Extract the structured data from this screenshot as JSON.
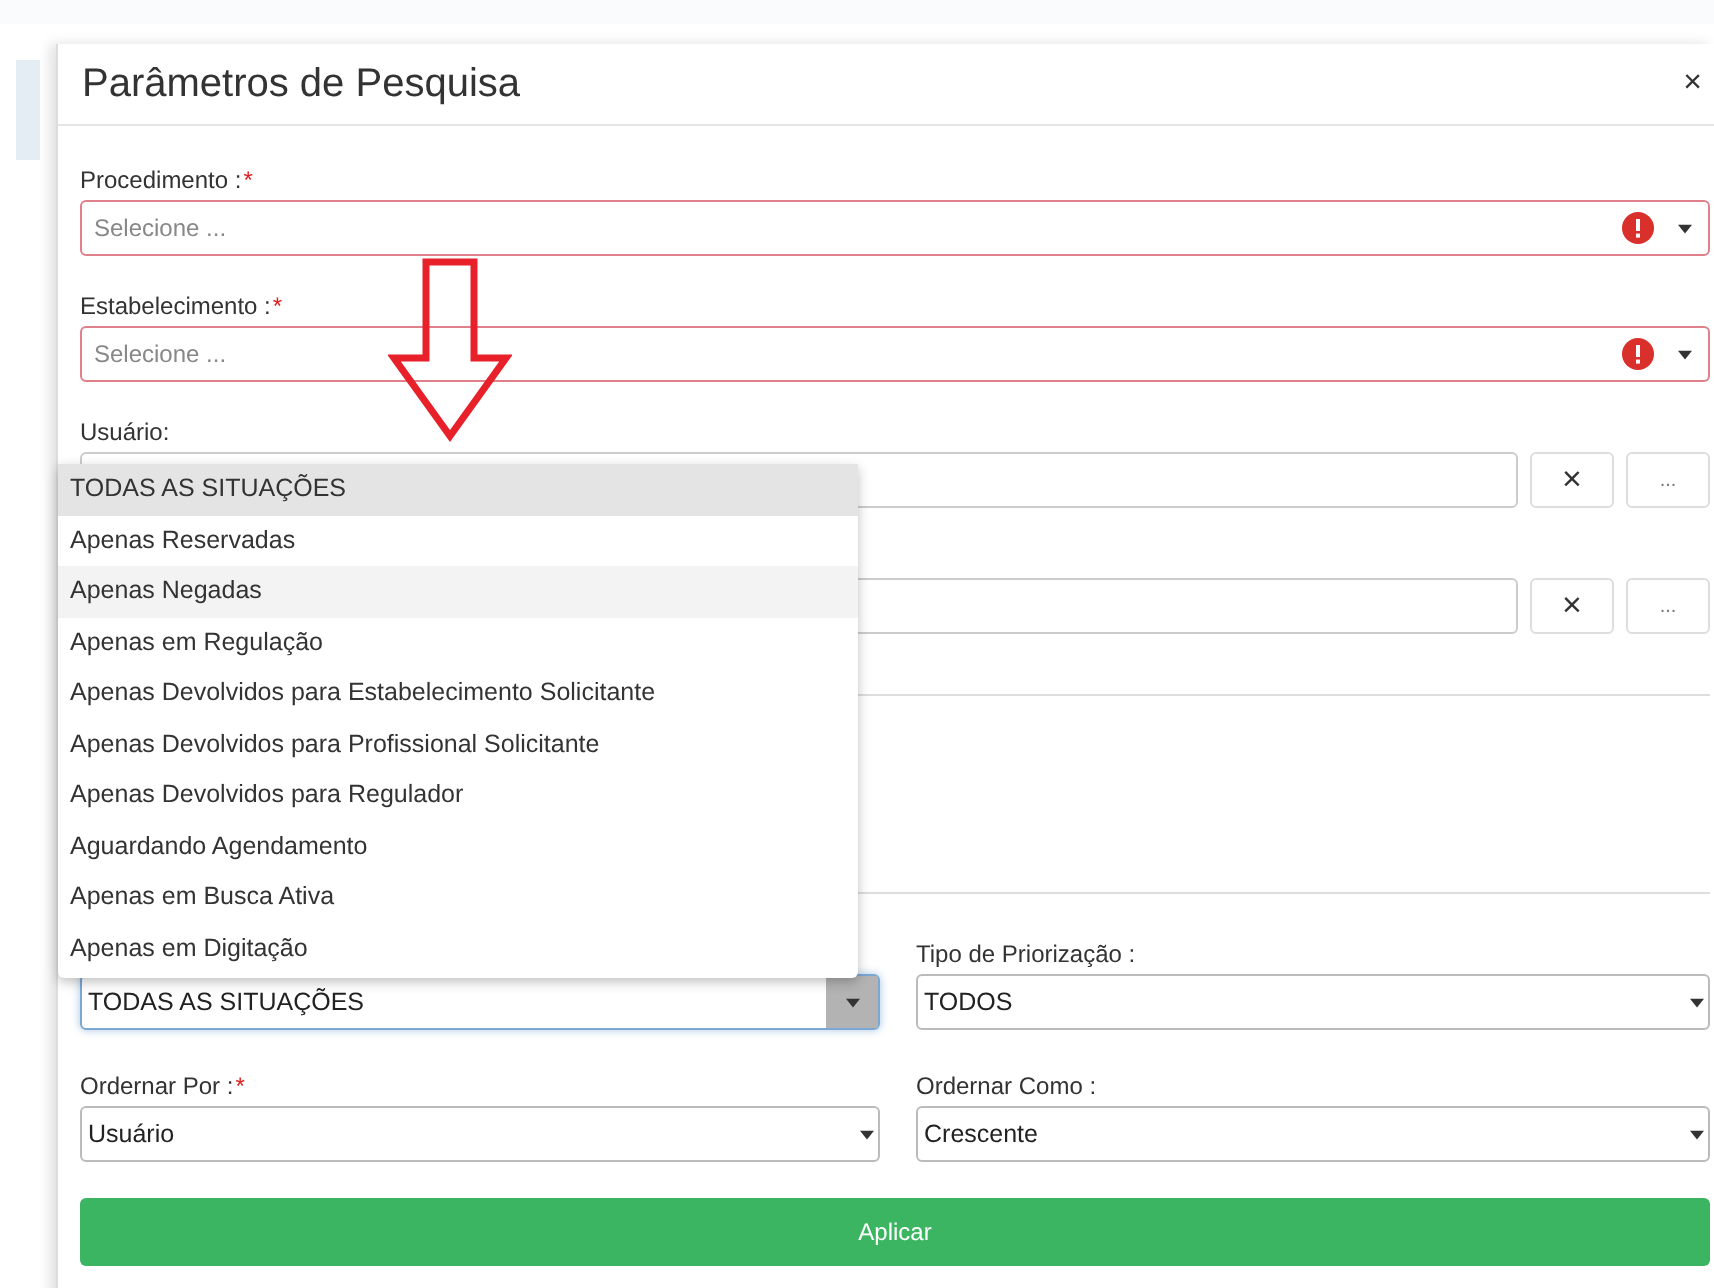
{
  "dialog": {
    "title": "Parâmetros de Pesquisa",
    "close": "×"
  },
  "selects": [
    {
      "label": "Procedimento :",
      "required_mark": "*",
      "placeholder": "Selecione ...",
      "error": true
    },
    {
      "label": "Estabelecimento :",
      "required_mark": "*",
      "placeholder": "Selecione ...",
      "error": true
    }
  ],
  "lookups": [
    {
      "label": "Usuário:",
      "clear": "×",
      "browse": "..."
    },
    {
      "clear": "×",
      "browse": "..."
    }
  ],
  "situation": {
    "value": "TODAS AS SITUAÇÕES",
    "expanded": true,
    "options": [
      {
        "label": "TODAS AS SITUAÇÕES",
        "selected": true,
        "hovered": false
      },
      {
        "label": "Apenas Reservadas",
        "selected": false,
        "hovered": false
      },
      {
        "label": "Apenas Negadas",
        "selected": false,
        "hovered": true
      },
      {
        "label": "Apenas em Regulação",
        "selected": false,
        "hovered": false
      },
      {
        "label": "Apenas Devolvidos para Estabelecimento Solicitante",
        "selected": false,
        "hovered": false
      },
      {
        "label": "Apenas Devolvidos para Profissional Solicitante",
        "selected": false,
        "hovered": false
      },
      {
        "label": "Apenas Devolvidos para Regulador",
        "selected": false,
        "hovered": false
      },
      {
        "label": "Aguardando Agendamento",
        "selected": false,
        "hovered": false
      },
      {
        "label": "Apenas em Busca Ativa",
        "selected": false,
        "hovered": false
      },
      {
        "label": "Apenas em Digitação",
        "selected": false,
        "hovered": false
      }
    ]
  },
  "priority": {
    "label": "Tipo de Priorização :",
    "value": "TODOS"
  },
  "order_by": {
    "label": "Ordernar Por :",
    "required_mark": "*",
    "value": "Usuário"
  },
  "order_dir": {
    "label": "Ordernar Como :",
    "value": "Crescente"
  },
  "apply_button": "Aplicar"
}
